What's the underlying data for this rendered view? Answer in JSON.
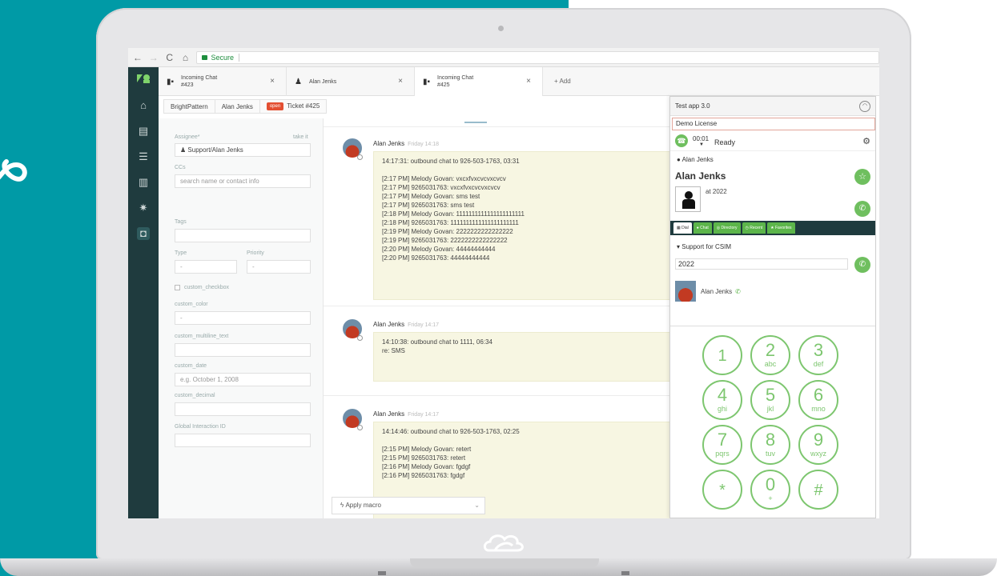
{
  "browser": {
    "secure_label": "Secure"
  },
  "tabs": [
    {
      "title": "Incoming Chat",
      "subtitle": "#423",
      "close": "×"
    },
    {
      "title": "Alan Jenks",
      "subtitle": "",
      "close": "×"
    },
    {
      "title": "Incoming Chat",
      "subtitle": "#425",
      "close": "×"
    }
  ],
  "tab_add_label": "+ Add",
  "breadcrumb": {
    "org": "BrightPattern",
    "user": "Alan Jenks",
    "status": "open",
    "ticket": "Ticket #425"
  },
  "properties": {
    "assignee_label": "Assignee*",
    "take_it": "take it",
    "assignee_value": "Support/Alan Jenks",
    "ccs_label": "CCs",
    "ccs_placeholder": "search name or contact info",
    "tags_label": "Tags",
    "type_label": "Type",
    "type_value": "-",
    "priority_label": "Priority",
    "priority_value": "-",
    "checkbox_label": "custom_checkbox",
    "color_label": "custom_color",
    "color_value": "-",
    "multiline_label": "custom_multiline_text",
    "date_label": "custom_date",
    "date_placeholder": "e.g. October 1, 2008",
    "decimal_label": "custom_decimal",
    "gid_label": "Global Interaction ID"
  },
  "messages": [
    {
      "sender": "Alan Jenks",
      "when": "Friday 14:18",
      "lines": [
        "14:17:31: outbound chat to 926-503-1763, 03:31",
        "",
        "[2:17 PM] Melody Govan: vxcxfvxcvcvxcvcv",
        "[2:17 PM] 9265031763: vxcxfvxcvcvxcvcv",
        "[2:17 PM] Melody Govan: sms test",
        "[2:17 PM] 9265031763: sms test",
        "[2:18 PM] Melody Govan: 1111111111111111111111",
        "[2:18 PM] 9265031763: 1111111111111111111111",
        "[2:19 PM] Melody Govan: 2222222222222222",
        "[2:19 PM] 9265031763: 2222222222222222",
        "[2:20 PM] Melody Govan: 44444444444",
        "[2:20 PM] 9265031763: 44444444444"
      ]
    },
    {
      "sender": "Alan Jenks",
      "when": "Friday 14:17",
      "lines": [
        "14:10:38: outbound chat to 1111, 06:34",
        "re: SMS"
      ]
    },
    {
      "sender": "Alan Jenks",
      "when": "Friday 14:17",
      "lines": [
        "14:14:46: outbound chat to 926-503-1763, 02:25",
        "",
        "[2:15 PM] Melody Govan: retert",
        "[2:15 PM] 9265031763: retert",
        "[2:16 PM] Melody Govan: fgdgf",
        "[2:16 PM] 9265031763: fgdgf"
      ]
    }
  ],
  "macro": {
    "label": "Apply macro",
    "chevron": "⌄"
  },
  "softphone": {
    "app_title": "Test app 3.0",
    "license": "Demo License",
    "timer": "00:01",
    "state": "Ready",
    "user": "Alan Jenks",
    "contact_name": "Alan Jenks",
    "contact_detail": "at 2022",
    "tabs": [
      "Dial",
      "Chat",
      "Directory",
      "Recent",
      "Favorites"
    ],
    "section": "Support for CSIM",
    "dial_value": "2022",
    "recent_name": "Alan Jenks",
    "keypad": [
      {
        "d": "1",
        "l": ""
      },
      {
        "d": "2",
        "l": "abc"
      },
      {
        "d": "3",
        "l": "def"
      },
      {
        "d": "4",
        "l": "ghi"
      },
      {
        "d": "5",
        "l": "jkl"
      },
      {
        "d": "6",
        "l": "mno"
      },
      {
        "d": "7",
        "l": "pqrs"
      },
      {
        "d": "8",
        "l": "tuv"
      },
      {
        "d": "9",
        "l": "wxyz"
      },
      {
        "d": "*",
        "l": ""
      },
      {
        "d": "0",
        "l": "+"
      },
      {
        "d": "#",
        "l": ""
      }
    ]
  },
  "colors": {
    "teal": "#009aa6",
    "sidebar": "#1f3b3e",
    "accent_green": "#6fbf5f",
    "open_badge": "#e34f32",
    "bubble": "#f7f6e2"
  }
}
